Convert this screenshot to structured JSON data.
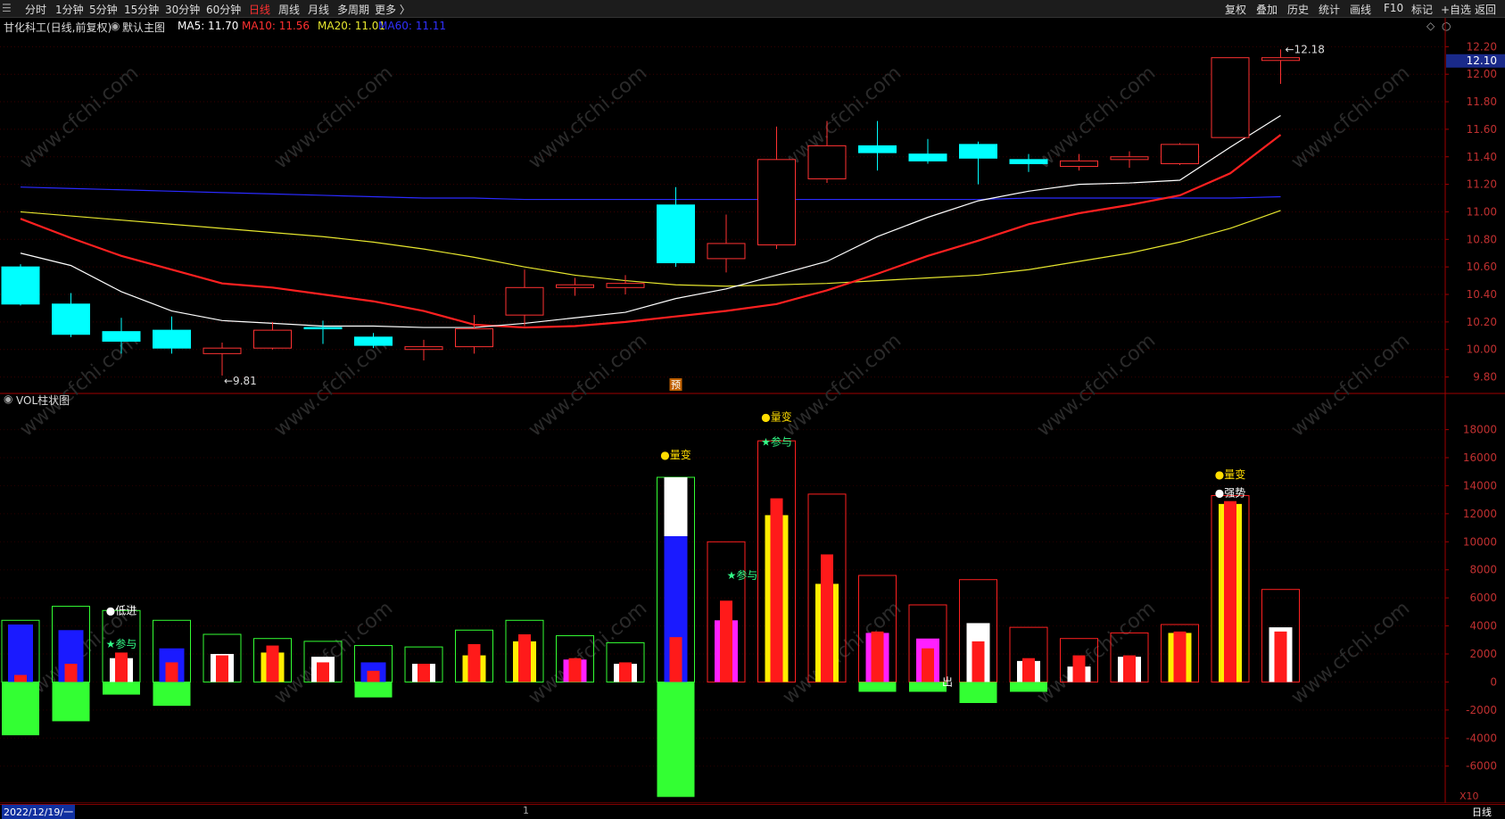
{
  "toolbar": {
    "left_items": [
      "分时",
      "1分钟",
      "5分钟",
      "15分钟",
      "30分钟",
      "60分钟",
      "日线",
      "周线",
      "月线",
      "多周期",
      "更多 〉"
    ],
    "active_item": "日线",
    "right_items": [
      "复权",
      "叠加",
      "历史",
      "统计",
      "画线",
      "F10",
      "标记",
      "+自选",
      "返回"
    ]
  },
  "main_chart": {
    "title": "甘化科工(日线,前复权)",
    "indicator_name": "默认主图",
    "ma5_label": "MA5: 11.70",
    "ma10_label": "MA10: 11.56",
    "ma20_label": "MA20: 11.01",
    "ma60_label": "MA60: 11.11",
    "current_price": "12.10",
    "high_marker": "12.18",
    "low_marker": "9.81",
    "forecast_badge": "预",
    "price_axis": [
      "12.20",
      "12.00",
      "11.80",
      "11.60",
      "11.40",
      "11.20",
      "11.00",
      "10.80",
      "10.60",
      "10.40",
      "10.20",
      "10.00",
      "9.80"
    ],
    "colors": {
      "up": "#ff3232",
      "down": "#00ffff",
      "ma5": "#ffffff",
      "ma10": "#ff2020",
      "ma20": "#e6e62e",
      "ma60": "#2a2aff"
    }
  },
  "chart_data": [
    {
      "type": "candlestick",
      "title": "甘化科工(日线,前复权)",
      "candles": [
        {
          "o": 10.6,
          "c": 10.33,
          "h": 10.62,
          "l": 10.32
        },
        {
          "o": 10.33,
          "c": 10.11,
          "h": 10.41,
          "l": 10.09
        },
        {
          "o": 10.13,
          "c": 10.06,
          "h": 10.23,
          "l": 9.97
        },
        {
          "o": 10.14,
          "c": 10.01,
          "h": 10.24,
          "l": 9.97
        },
        {
          "o": 9.97,
          "c": 10.01,
          "h": 10.05,
          "l": 9.81
        },
        {
          "o": 10.01,
          "c": 10.14,
          "h": 10.2,
          "l": 10.0
        },
        {
          "o": 10.16,
          "c": 10.15,
          "h": 10.21,
          "l": 10.04
        },
        {
          "o": 10.09,
          "c": 10.03,
          "h": 10.12,
          "l": 10.01
        },
        {
          "o": 10.0,
          "c": 10.02,
          "h": 10.07,
          "l": 9.92
        },
        {
          "o": 10.02,
          "c": 10.15,
          "h": 10.25,
          "l": 9.97
        },
        {
          "o": 10.25,
          "c": 10.45,
          "h": 10.58,
          "l": 10.17
        },
        {
          "o": 10.45,
          "c": 10.47,
          "h": 10.52,
          "l": 10.39
        },
        {
          "o": 10.45,
          "c": 10.48,
          "h": 10.54,
          "l": 10.4
        },
        {
          "o": 11.05,
          "c": 10.63,
          "h": 11.18,
          "l": 10.6
        },
        {
          "o": 10.66,
          "c": 10.77,
          "h": 10.98,
          "l": 10.56
        },
        {
          "o": 10.76,
          "c": 11.38,
          "h": 11.62,
          "l": 10.73
        },
        {
          "o": 11.24,
          "c": 11.48,
          "h": 11.66,
          "l": 11.21
        },
        {
          "o": 11.48,
          "c": 11.43,
          "h": 11.66,
          "l": 11.3
        },
        {
          "o": 11.42,
          "c": 11.37,
          "h": 11.53,
          "l": 11.35
        },
        {
          "o": 11.49,
          "c": 11.39,
          "h": 11.51,
          "l": 11.2
        },
        {
          "o": 11.38,
          "c": 11.35,
          "h": 11.42,
          "l": 11.29
        },
        {
          "o": 11.33,
          "c": 11.37,
          "h": 11.42,
          "l": 11.3
        },
        {
          "o": 11.38,
          "c": 11.4,
          "h": 11.44,
          "l": 11.32
        },
        {
          "o": 11.35,
          "c": 11.49,
          "h": 11.5,
          "l": 11.34
        },
        {
          "o": 11.54,
          "c": 12.12,
          "h": 12.12,
          "l": 11.54
        },
        {
          "o": 12.1,
          "c": 12.12,
          "h": 12.18,
          "l": 11.93
        }
      ],
      "ma5": [
        10.7,
        10.61,
        10.42,
        10.28,
        10.21,
        10.19,
        10.17,
        10.17,
        10.16,
        10.16,
        10.19,
        10.23,
        10.27,
        10.37,
        10.44,
        10.54,
        10.64,
        10.82,
        10.96,
        11.08,
        11.15,
        11.2,
        11.21,
        11.23,
        11.47,
        11.7
      ],
      "ma10": [
        10.95,
        10.81,
        10.68,
        10.58,
        10.48,
        10.45,
        10.4,
        10.35,
        10.28,
        10.18,
        10.16,
        10.17,
        10.2,
        10.24,
        10.28,
        10.33,
        10.43,
        10.55,
        10.68,
        10.79,
        10.91,
        10.99,
        11.05,
        11.12,
        11.28,
        11.56
      ],
      "ma20": [
        11.0,
        10.97,
        10.94,
        10.91,
        10.88,
        10.85,
        10.82,
        10.78,
        10.73,
        10.67,
        10.6,
        10.54,
        10.5,
        10.47,
        10.46,
        10.47,
        10.48,
        10.5,
        10.52,
        10.54,
        10.58,
        10.64,
        10.7,
        10.78,
        10.88,
        11.01
      ],
      "ma60": [
        11.18,
        11.17,
        11.16,
        11.15,
        11.14,
        11.13,
        11.12,
        11.11,
        11.1,
        11.1,
        11.09,
        11.09,
        11.09,
        11.09,
        11.09,
        11.09,
        11.09,
        11.09,
        11.09,
        11.09,
        11.1,
        11.1,
        11.1,
        11.1,
        11.1,
        11.11
      ],
      "ylim": [
        9.7,
        12.28
      ]
    },
    {
      "type": "bar",
      "title": "VOL柱状图",
      "outer_volume": [
        4400,
        5400,
        5100,
        4400,
        3400,
        3100,
        2900,
        2600,
        2500,
        3700,
        4400,
        3300,
        2800,
        14600,
        10000,
        17200,
        13400,
        7600,
        5500,
        7300,
        3900,
        3100,
        3500,
        4100,
        13300,
        6600
      ],
      "outer_color": [
        "green",
        "green",
        "green",
        "green",
        "green",
        "green",
        "green",
        "green",
        "green",
        "green",
        "green",
        "green",
        "green",
        "green",
        "red",
        "red",
        "red",
        "red",
        "red",
        "red",
        "red",
        "red",
        "red",
        "red",
        "red",
        "red"
      ],
      "inner_main": [
        4100,
        3700,
        1700,
        2400,
        2000,
        2100,
        1800,
        1400,
        1300,
        1900,
        2900,
        1600,
        1300,
        14600,
        4400,
        11900,
        7000,
        3500,
        3100,
        4200,
        1500,
        1100,
        1800,
        3500,
        12700,
        3900
      ],
      "inner_main_color": [
        "blue",
        "blue",
        "white",
        "blue",
        "white",
        "yellow",
        "white",
        "blue",
        "white",
        "yellow",
        "yellow",
        "magenta",
        "white",
        "white",
        "magenta",
        "yellow",
        "yellow",
        "magenta",
        "magenta",
        "white",
        "white",
        "white",
        "white",
        "yellow",
        "yellow",
        "white"
      ],
      "inner_secondary": [
        500,
        1300,
        2100,
        1400,
        1900,
        2600,
        1400,
        800,
        1300,
        2700,
        3400,
        1700,
        1400,
        3200,
        5800,
        13100,
        9100,
        3600,
        2400,
        2900,
        1700,
        1900,
        1900,
        3600,
        12900,
        3600
      ],
      "inner_blue_mid": [
        null,
        null,
        null,
        null,
        null,
        null,
        null,
        null,
        null,
        null,
        null,
        null,
        null,
        10400,
        null,
        null,
        null,
        null,
        null,
        null,
        null,
        null,
        null,
        null,
        null,
        null
      ],
      "negative": [
        -3800,
        -2800,
        -900,
        -1700,
        0,
        0,
        0,
        -1100,
        0,
        0,
        0,
        0,
        0,
        -8200,
        0,
        0,
        0,
        -700,
        -700,
        -1500,
        -700,
        0,
        0,
        0,
        0,
        0
      ],
      "ylim": [
        -8500,
        19500
      ],
      "y_ticks": [
        "18000",
        "16000",
        "14000",
        "12000",
        "10000",
        "8000",
        "6000",
        "4000",
        "2000",
        "0",
        "-2000",
        "-4000",
        "-6000"
      ],
      "annotations": [
        {
          "index": 2,
          "text": "●低进",
          "color": "#ffffff",
          "value": 5100
        },
        {
          "index": 2,
          "text": "★参与",
          "color": "#33ff88",
          "value": 2700
        },
        {
          "index": 13,
          "text": "●量变",
          "color": "#ffdd00",
          "value": 16200
        },
        {
          "index": 14,
          "text": "★参与",
          "color": "#33ff88",
          "value": 7600
        },
        {
          "index": 15,
          "text": "★参与",
          "color": "#33ff88",
          "value": 17100
        },
        {
          "index": 15,
          "text": "●量变",
          "color": "#ffdd00",
          "value": 18900
        },
        {
          "index": 24,
          "text": "●量变",
          "color": "#ffdd00",
          "value": 14800
        },
        {
          "index": 24,
          "text": "●强势",
          "color": "#ffffff",
          "value": 13500
        },
        {
          "index": 18,
          "text": "出",
          "color": "#ffffff",
          "value": 0
        }
      ],
      "scale_label": "X10"
    }
  ],
  "volume_panel": {
    "title": "VOL柱状图"
  },
  "bottom_bar": {
    "date": "2022/12/19/一",
    "marker": "1",
    "period": "日线"
  }
}
